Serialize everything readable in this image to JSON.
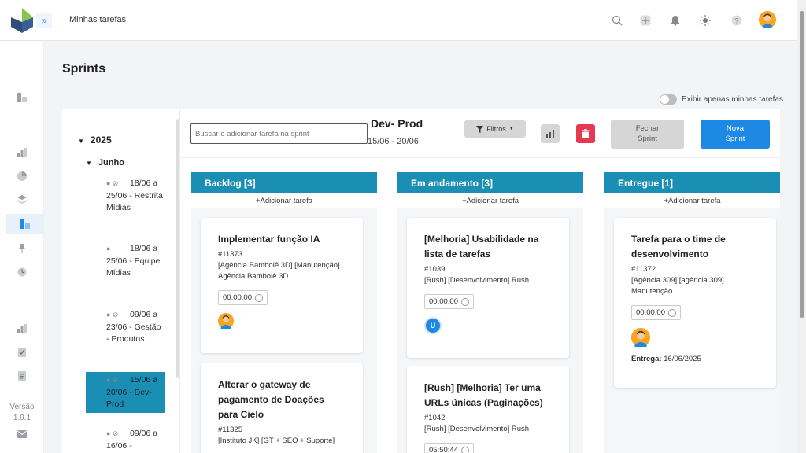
{
  "header": {
    "breadcrumb": "Minhas tarefas",
    "icons": [
      "search-icon",
      "plus-icon",
      "bell-icon",
      "sun-icon",
      "help-icon"
    ]
  },
  "sidebar": {
    "icons": [
      "sprint-icon",
      "chart-icon",
      "pie-icon",
      "layers-icon",
      "board-icon",
      "pin-icon",
      "clock-icon",
      "chart-icon",
      "check-icon",
      "document-icon",
      "mail-icon"
    ],
    "version_label": "Versão",
    "version_number": "1.9.1"
  },
  "page": {
    "title": "Sprints",
    "toggle_label": "Exibir apenas minhas tarefas"
  },
  "tree": {
    "year": "2025",
    "month": "Junho",
    "sprints": [
      {
        "label": "18/06 a 25/06 - Restrita Mídias",
        "active": false
      },
      {
        "label": "18/06 a 25/06 - Equipe Mídias",
        "active": false
      },
      {
        "label": "09/06 a 23/06 - Gestão - Produtos",
        "active": false
      },
      {
        "label": "15/06 a 20/06 - Dev- Prod",
        "active": true
      },
      {
        "label": "09/06 a 16/06 -",
        "active": false
      }
    ]
  },
  "board": {
    "search_placeholder": "Buscar e adicionar tarefa na sprint",
    "sprint_name": "Dev- Prod",
    "sprint_dates": "15/06 - 20/06",
    "filter_label": "Filtros",
    "close_sprint_label_1": "Fechar",
    "close_sprint_label_2": "Sprint",
    "new_sprint_label_1": "Nova",
    "new_sprint_label_2": "Sprint",
    "add_task_label": "Adicionar tarefa",
    "columns": [
      {
        "title": "Backlog [3]",
        "cards": [
          {
            "title": "Implementar função IA",
            "number": "#11373",
            "tags": "[Agência Bambolê 3D] [Manutenção] Agência Bambolê 3D",
            "timer": "00:00:00"
          },
          {
            "title": "Alterar o gateway de pagamento de Doações para Cielo",
            "number": "#11325",
            "tags": "[Instituto JK] [GT + SEO + Suporte]",
            "timer": ""
          }
        ]
      },
      {
        "title": "Em andamento [3]",
        "cards": [
          {
            "title": "[Melhoria] Usabilidade na lista de tarefas",
            "number": "#1039",
            "tags": "[Rush] [Desenvolvimento] Rush",
            "timer": "00:00:00",
            "avatar_initial": "U"
          },
          {
            "title": "[Rush] [Melhoria] Ter uma URLs únicas (Paginações)",
            "number": "#1042",
            "tags": "[Rush] [Desenvolvimento] Rush",
            "timer": "05:50:44"
          }
        ]
      },
      {
        "title": "Entregue [1]",
        "cards": [
          {
            "title": "Tarefa para o time de desenvolvimento",
            "number": "#11372",
            "tags": "[Agência 309] [agência 309] Manutenção",
            "timer": "00:00:00",
            "delivery_label": "Entrega:",
            "delivery_date": "16/06/2025"
          }
        ]
      }
    ]
  },
  "colors": {
    "accent": "#1e88e5",
    "column_header": "#1b8fb3",
    "delete": "#e53951"
  }
}
